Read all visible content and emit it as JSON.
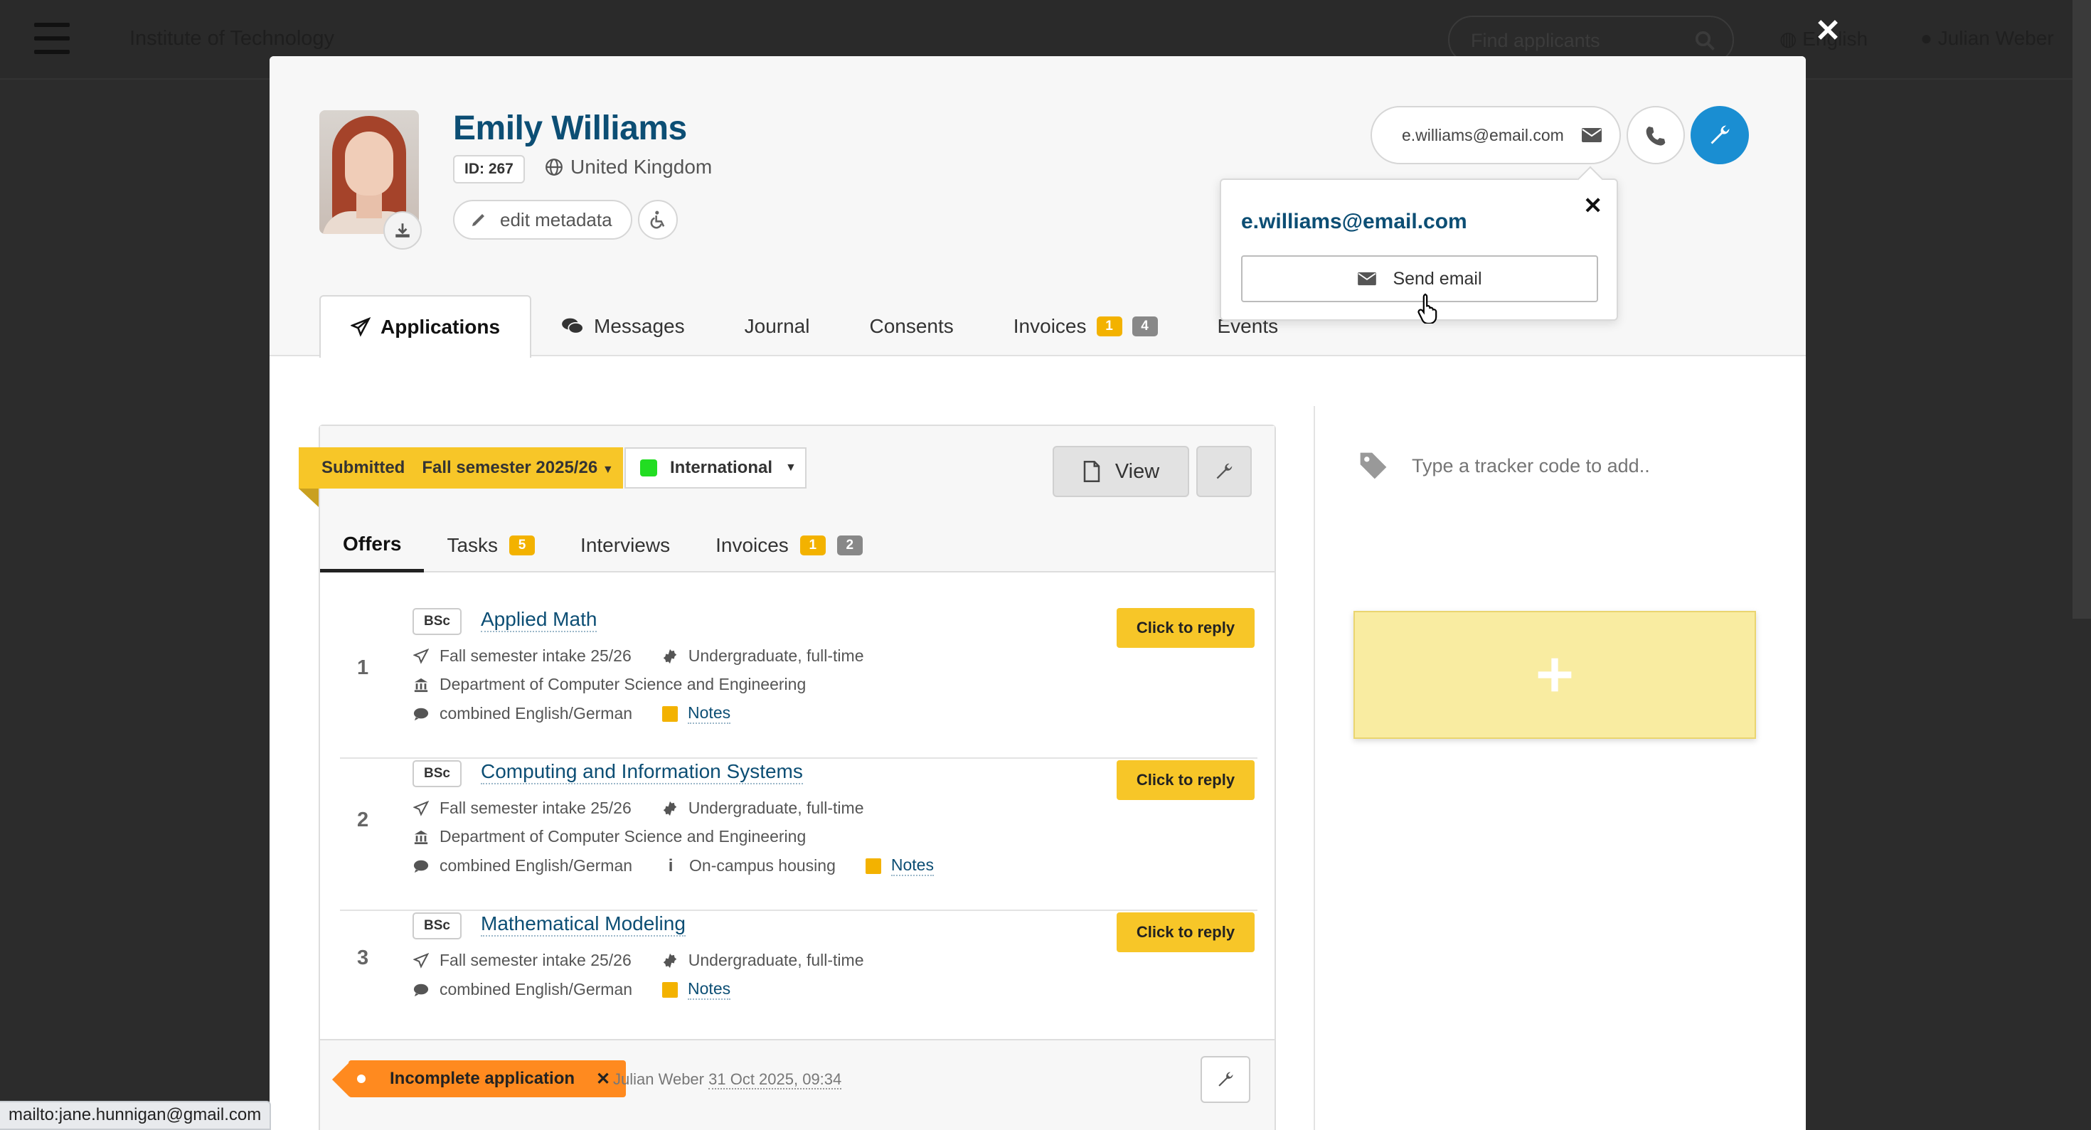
{
  "background": {
    "institute": "Institute of Technology",
    "search_placeholder": "Find applicants",
    "language": "English",
    "user": "Julian Weber"
  },
  "applicant": {
    "name": "Emily Williams",
    "id_label": "ID: 267",
    "country": "United Kingdom",
    "edit_metadata_label": "edit metadata",
    "email": "e.williams@email.com"
  },
  "popover": {
    "email": "e.williams@email.com",
    "send_email_label": "Send email"
  },
  "tabs": [
    {
      "label": "Applications",
      "icon": "paper-plane-icon",
      "active": true
    },
    {
      "label": "Messages",
      "icon": "comments-icon"
    },
    {
      "label": "Journal"
    },
    {
      "label": "Consents"
    },
    {
      "label": "Invoices",
      "badges": [
        "1",
        "4"
      ]
    },
    {
      "label": "Events"
    }
  ],
  "application": {
    "status": "Submitted",
    "intake": "Fall semester 2025/26",
    "category": "International",
    "view_label": "View",
    "subtabs": [
      {
        "label": "Offers",
        "active": true
      },
      {
        "label": "Tasks",
        "badges": [
          "5"
        ]
      },
      {
        "label": "Interviews"
      },
      {
        "label": "Invoices",
        "badges": [
          "1",
          "2"
        ]
      }
    ],
    "offers": [
      {
        "num": "1",
        "degree": "BSc",
        "title": "Applied Math",
        "intake": "Fall semester intake 25/26",
        "level": "Undergraduate, full-time",
        "department": "Department of Computer Science and Engineering",
        "language": "combined English/German",
        "extra": "",
        "notes": "Notes",
        "reply_label": "Click to reply"
      },
      {
        "num": "2",
        "degree": "BSc",
        "title": "Computing and Information Systems",
        "intake": "Fall semester intake 25/26",
        "level": "Undergraduate, full-time",
        "department": "Department of Computer Science and Engineering",
        "language": "combined English/German",
        "extra": "On-campus housing",
        "notes": "Notes",
        "reply_label": "Click to reply"
      },
      {
        "num": "3",
        "degree": "BSc",
        "title": "Mathematical Modeling",
        "intake": "Fall semester intake 25/26",
        "level": "Undergraduate, full-time",
        "department": "",
        "language": "combined English/German",
        "extra": "",
        "notes": "Notes",
        "reply_label": "Click to reply"
      }
    ],
    "footer": {
      "flag": "Incomplete application",
      "author": "Julian Weber",
      "date": "31 Oct 2025, 09:34"
    }
  },
  "tracker": {
    "placeholder": "Type a tracker code to add.."
  },
  "status_bar": {
    "url": "mailto:jane.hunnigan@gmail.com"
  },
  "colors": {
    "accent_blue": "#1a8ed2",
    "name_blue": "#0c4e74",
    "status_yellow": "#f7c628",
    "badge_yellow": "#f3b200",
    "incomplete_orange": "#ff8a1f",
    "international_green": "#22dd22"
  }
}
